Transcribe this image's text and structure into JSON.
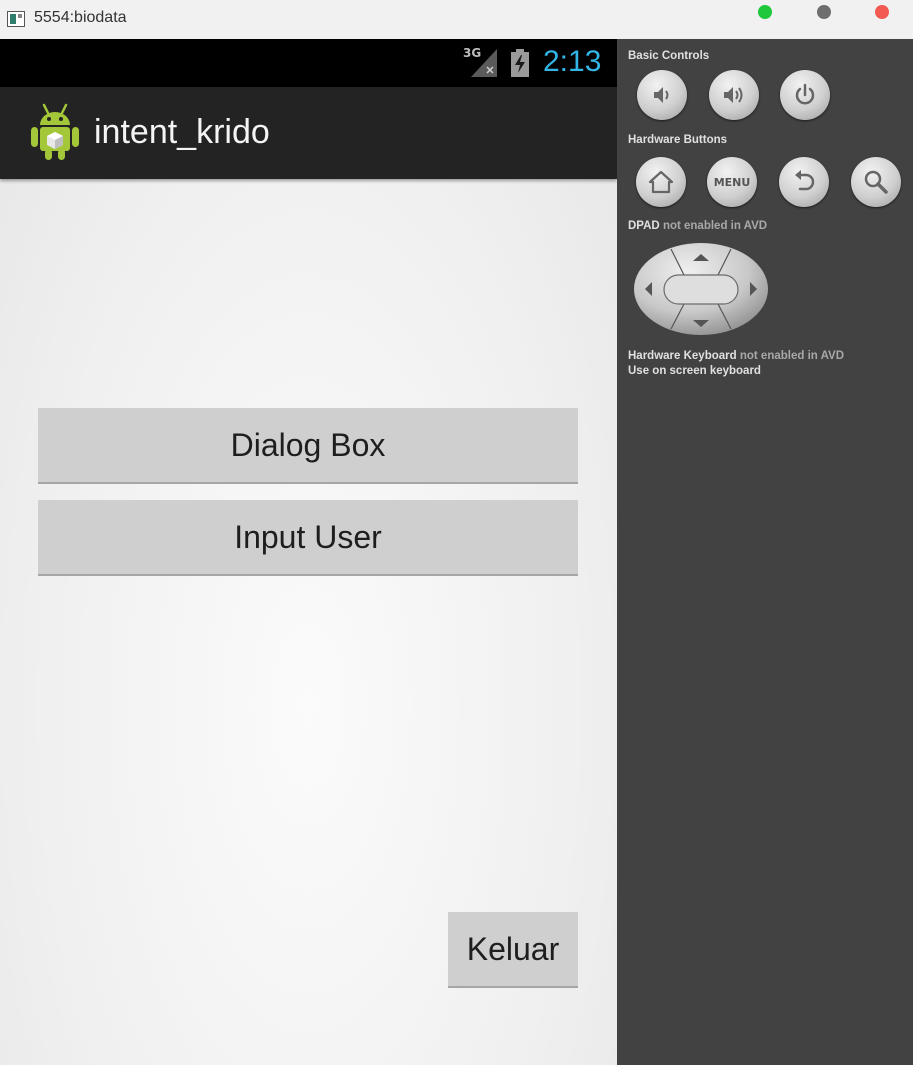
{
  "window": {
    "title": "5554:biodata"
  },
  "status_bar": {
    "network": "3G",
    "time": "2:13"
  },
  "action_bar": {
    "app_title": "intent_krido"
  },
  "buttons": {
    "dialog_box": "Dialog Box",
    "input_user": "Input User",
    "keluar": "Keluar"
  },
  "controls_panel": {
    "basic_controls_label": "Basic Controls",
    "hardware_buttons_label": "Hardware Buttons",
    "menu_label": "MENU",
    "dpad_label_bold": "DPAD",
    "dpad_label_rest": "not enabled in AVD",
    "keyboard_label_bold": "Hardware Keyboard",
    "keyboard_label_rest": "not enabled in AVD",
    "keyboard_label_line2": "Use on screen keyboard"
  },
  "colors": {
    "clock": "#33b5e5",
    "action_bar": "#232323",
    "controls_bg": "#424242",
    "android_green": "#a4c639",
    "window_green": "#1fc83b",
    "window_gray": "#6e6e6e",
    "window_red": "#f25a52"
  }
}
